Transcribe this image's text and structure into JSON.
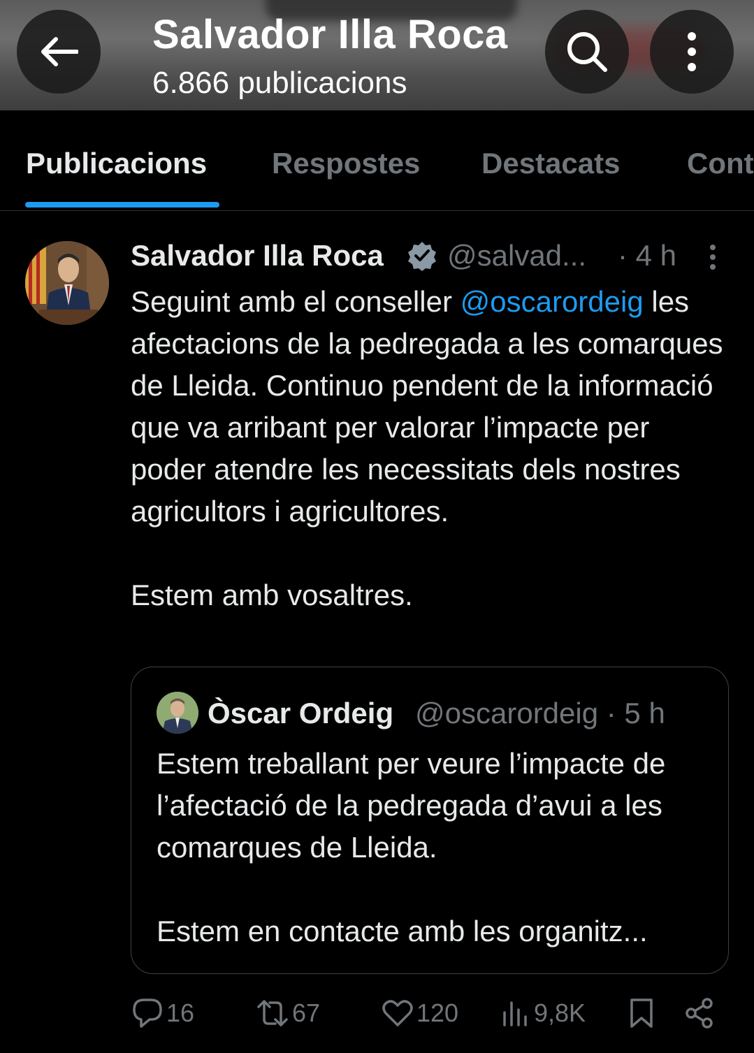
{
  "header": {
    "title": "Salvador Illa Roca",
    "subtitle": "6.866 publicacions"
  },
  "tabs": [
    {
      "label": "Publicacions",
      "active": true
    },
    {
      "label": "Respostes",
      "active": false
    },
    {
      "label": "Destacats",
      "active": false
    },
    {
      "label": "Cont",
      "active": false
    }
  ],
  "tweet": {
    "author_name": "Salvador Illa Roca",
    "handle": "@salvad...",
    "time": "· 4 h",
    "text_before_mention": "Seguint amb el conseller ",
    "mention": "@oscarordeig",
    "text_after_mention": " les afectacions de la pedregada a les comarques de Lleida. Continuo pendent de la informació que va arribant per valorar l’impacte per poder atendre les necessitats dels nostres agricultors i agricultores.",
    "text_paragraph_2": "Estem amb vosaltres.",
    "quote": {
      "author_name": "Òscar Ordeig",
      "handle_time": "@oscarordeig · 5 h",
      "paragraph_1": "Estem treballant per veure l’impacte de l’afectació de la pedregada d’avui a les comarques de Lleida.",
      "paragraph_2": "Estem en contacte amb les organitz..."
    },
    "stats": {
      "replies": "16",
      "reposts": "67",
      "likes": "120",
      "views": "9,8K"
    }
  },
  "colors": {
    "accent": "#1d9bf0",
    "muted": "#71767b",
    "text": "#e7e9ea",
    "background": "#000000"
  },
  "icons": [
    "back-arrow-icon",
    "search-icon",
    "more-vertical-icon",
    "verified-badge-icon",
    "reply-icon",
    "repost-icon",
    "like-icon",
    "views-icon",
    "bookmark-icon",
    "share-icon"
  ]
}
